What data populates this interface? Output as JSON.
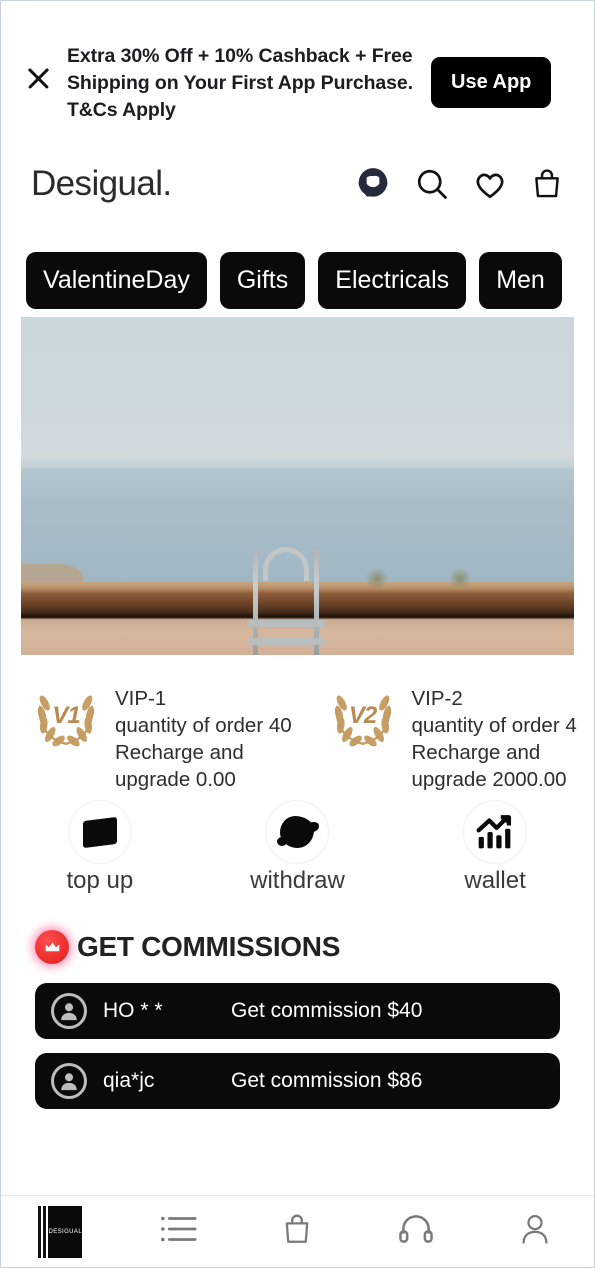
{
  "promo": {
    "close_icon": "close-icon",
    "text": "Extra 30% Off + 10% Cashback + Free Shipping on Your First App Purchase. T&Cs Apply",
    "cta_label": "Use App"
  },
  "header": {
    "brand": "Desigual.",
    "icons": [
      "support-agent-icon",
      "search-icon",
      "heart-icon",
      "shopping-bag-icon"
    ]
  },
  "categories": [
    {
      "label": "ValentineDay"
    },
    {
      "label": "Gifts"
    },
    {
      "label": "Electricals"
    },
    {
      "label": "Men"
    }
  ],
  "hero": {
    "alt": "seaside view with pool ladder over stone wall"
  },
  "vip_levels": [
    {
      "badge_text": "V1",
      "title": "VIP-1",
      "quantity_line": "quantity of order 40",
      "recharge_line": "Recharge and",
      "upgrade_line": "upgrade 0.00"
    },
    {
      "badge_text": "V2",
      "title": "VIP-2",
      "quantity_line": "quantity of order 4",
      "recharge_line": "Recharge and",
      "upgrade_line": "upgrade 2000.00"
    }
  ],
  "actions": [
    {
      "label": "top up",
      "icon": "credit-card-icon"
    },
    {
      "label": "withdraw",
      "icon": "withdraw-icon"
    },
    {
      "label": "wallet",
      "icon": "growth-chart-icon"
    }
  ],
  "commissions": {
    "title": "GET COMMISSIONS",
    "badge_icon": "crown-icon",
    "rows": [
      {
        "user": "HO * *",
        "amount": "Get commission $40"
      },
      {
        "user": "qia*jc",
        "amount": "Get commission $86"
      }
    ]
  },
  "bottom_nav": [
    {
      "name": "home",
      "icon": "desigual-logo-icon",
      "label": "DESIGUAL"
    },
    {
      "name": "categories",
      "icon": "list-icon"
    },
    {
      "name": "cart",
      "icon": "shopping-bag-icon"
    },
    {
      "name": "support",
      "icon": "headset-icon"
    },
    {
      "name": "profile",
      "icon": "user-icon"
    }
  ],
  "colors": {
    "accent_black": "#0a0a0a",
    "vip_gold": "#c49a5e",
    "badge_red": "#e01b1b",
    "page_bg": "#ffffff"
  }
}
